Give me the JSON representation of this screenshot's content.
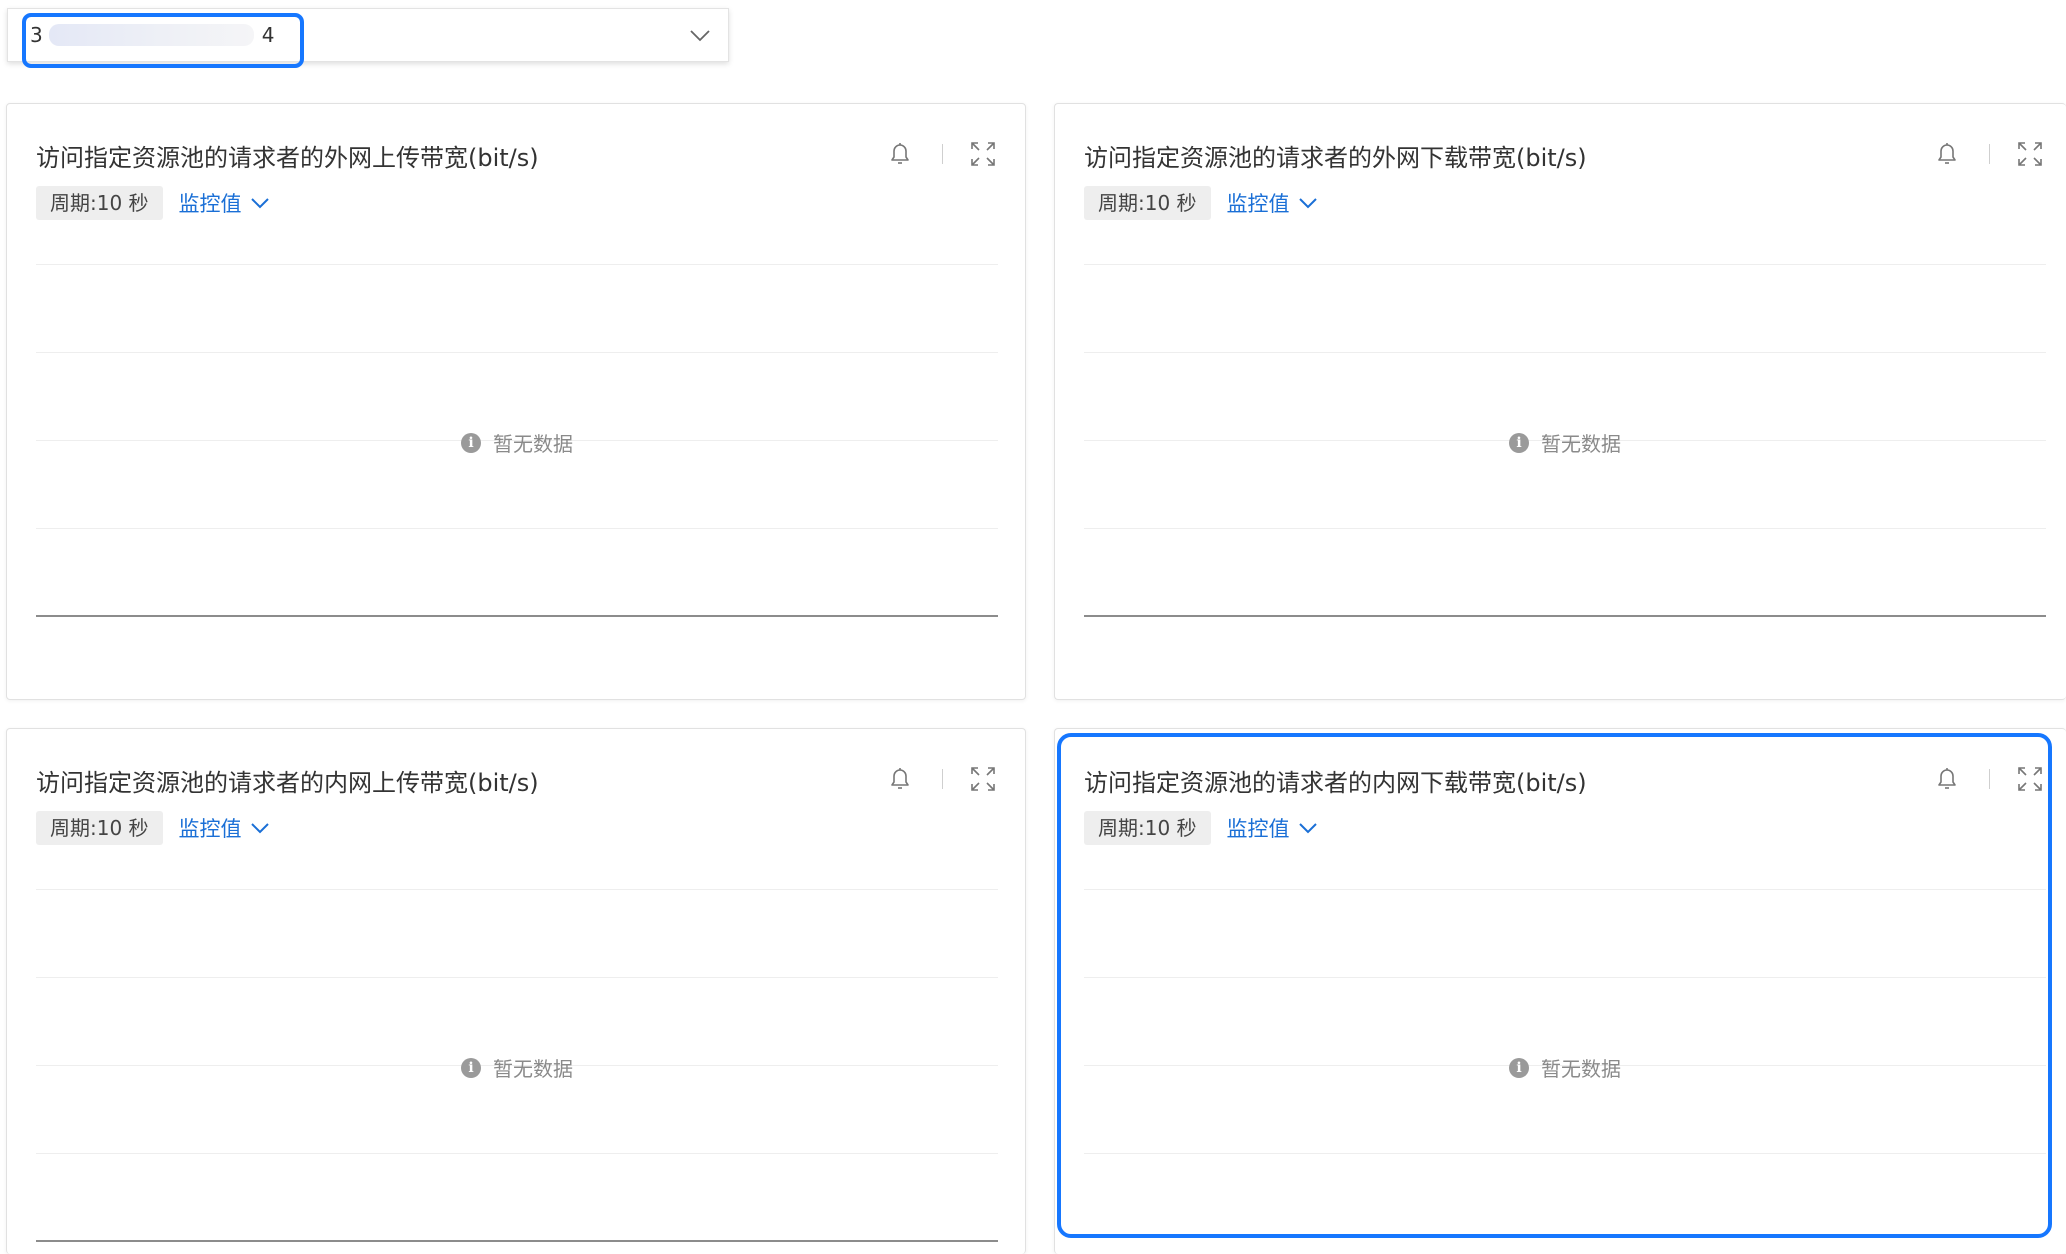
{
  "selector": {
    "value_prefix": "3",
    "value_suffix": "4"
  },
  "common": {
    "period_label": "周期:10 秒",
    "metric_label": "监控值",
    "empty_text": "暂无数据"
  },
  "panels": [
    {
      "title": "访问指定资源池的请求者的外网上传带宽(bit/s)"
    },
    {
      "title": "访问指定资源池的请求者的外网下载带宽(bit/s)"
    },
    {
      "title": "访问指定资源池的请求者的内网上传带宽(bit/s)"
    },
    {
      "title": "访问指定资源池的请求者的内网下载带宽(bit/s)"
    }
  ],
  "colors": {
    "accent": "#1677ff",
    "link": "#1a6fd6"
  },
  "icons": [
    "bell-icon",
    "expand-icon",
    "chevron-down-icon",
    "info-icon"
  ]
}
